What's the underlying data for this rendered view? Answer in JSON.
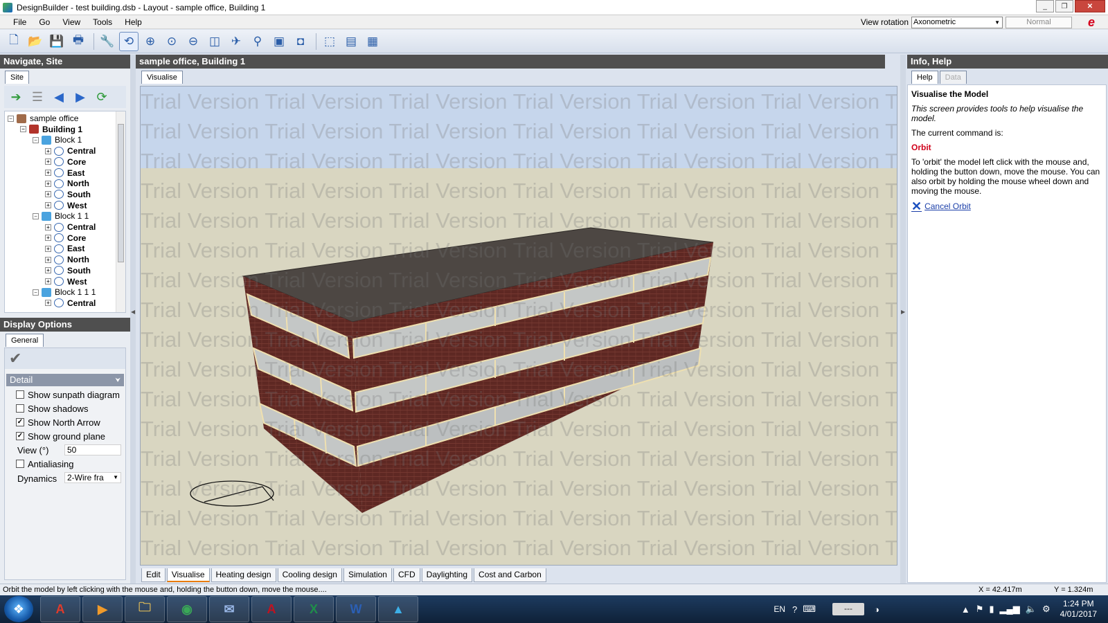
{
  "window": {
    "title": "DesignBuilder - test building.dsb - Layout - sample office, Building 1",
    "buttons": [
      "_",
      "❐",
      "✕"
    ]
  },
  "menu": {
    "items": [
      "File",
      "Go",
      "View",
      "Tools",
      "Help"
    ],
    "view_rotation_label": "View rotation",
    "view_rotation_value": "Axonometric",
    "mode_value": "Normal"
  },
  "toolbar": {
    "buttons": [
      {
        "name": "new-icon",
        "glyph": "🗋"
      },
      {
        "name": "open-icon",
        "glyph": "📂"
      },
      {
        "name": "save-icon",
        "glyph": "💾"
      },
      {
        "name": "print-icon",
        "glyph": "🖶"
      },
      {
        "name": "settings-wrench-icon",
        "glyph": "🔧"
      },
      {
        "name": "orbit-icon",
        "glyph": "⟲"
      },
      {
        "name": "zoom-icon",
        "glyph": "⊕"
      },
      {
        "name": "zoom-extents-icon",
        "glyph": "⊙"
      },
      {
        "name": "pan-icon",
        "glyph": "⊖"
      },
      {
        "name": "fit-icon",
        "glyph": "◫"
      },
      {
        "name": "fly-icon",
        "glyph": "✈"
      },
      {
        "name": "walk-icon",
        "glyph": "⚲"
      },
      {
        "name": "layers-icon",
        "glyph": "▣"
      },
      {
        "name": "camera-icon",
        "glyph": "◘"
      },
      {
        "name": "measure-icon",
        "glyph": "⬚"
      },
      {
        "name": "report-icon",
        "glyph": "▤"
      },
      {
        "name": "export-icon",
        "glyph": "▦"
      }
    ]
  },
  "navigate": {
    "header": "Navigate, Site",
    "tab": "Site",
    "tree": [
      {
        "label": "sample office",
        "level": 0,
        "icon": "site",
        "bold": false
      },
      {
        "label": "Building 1",
        "level": 1,
        "icon": "bldg",
        "bold": true
      },
      {
        "label": "Block 1",
        "level": 2,
        "icon": "block",
        "bold": false
      },
      {
        "label": "Central",
        "level": 3,
        "icon": "zone",
        "bold": true
      },
      {
        "label": "Core",
        "level": 3,
        "icon": "zone",
        "bold": true
      },
      {
        "label": "East",
        "level": 3,
        "icon": "zone",
        "bold": true
      },
      {
        "label": "North",
        "level": 3,
        "icon": "zone",
        "bold": true
      },
      {
        "label": "South",
        "level": 3,
        "icon": "zone",
        "bold": true
      },
      {
        "label": "West",
        "level": 3,
        "icon": "zone",
        "bold": true
      },
      {
        "label": "Block 1 1",
        "level": 2,
        "icon": "block",
        "bold": false
      },
      {
        "label": "Central",
        "level": 3,
        "icon": "zone",
        "bold": true
      },
      {
        "label": "Core",
        "level": 3,
        "icon": "zone",
        "bold": true
      },
      {
        "label": "East",
        "level": 3,
        "icon": "zone",
        "bold": true
      },
      {
        "label": "North",
        "level": 3,
        "icon": "zone",
        "bold": true
      },
      {
        "label": "South",
        "level": 3,
        "icon": "zone",
        "bold": true
      },
      {
        "label": "West",
        "level": 3,
        "icon": "zone",
        "bold": true
      },
      {
        "label": "Block 1 1 1",
        "level": 2,
        "icon": "block",
        "bold": false
      },
      {
        "label": "Central",
        "level": 3,
        "icon": "zone",
        "bold": true
      }
    ]
  },
  "display_options": {
    "header": "Display Options",
    "tab": "General",
    "section": "Detail",
    "options": [
      {
        "label": "Show sunpath diagram",
        "checked": false
      },
      {
        "label": "Show shadows",
        "checked": false
      },
      {
        "label": "Show North Arrow",
        "checked": true
      },
      {
        "label": "Show ground plane",
        "checked": true
      }
    ],
    "view_label": "View (°)",
    "view_value": "50",
    "antialiasing_label": "Antialiasing",
    "antialiasing_checked": false,
    "dynamics_label": "Dynamics",
    "dynamics_value": "2-Wire fra"
  },
  "center": {
    "header": "sample office, Building 1",
    "tab": "Visualise",
    "watermark": "Trial Version",
    "bottom_tabs": [
      "Edit",
      "Visualise",
      "Heating design",
      "Cooling design",
      "Simulation",
      "CFD",
      "Daylighting",
      "Cost and Carbon"
    ],
    "active_tab": "Visualise"
  },
  "help": {
    "header": "Info, Help",
    "tabs": [
      "Help",
      "Data"
    ],
    "title": "Visualise the Model",
    "description": "This screen provides tools to help visualise the model.",
    "command_label": "The current command is:",
    "command": "Orbit",
    "instructions": "To 'orbit' the model left click with the mouse and, holding the button down, move the mouse. You can also orbit by holding the mouse wheel down and moving the mouse.",
    "cancel_link": "Cancel Orbit"
  },
  "status": {
    "message": "Orbit the model by left clicking with the mouse and, holding the button down, move the mouse....",
    "x": "X = 42.417m",
    "y": "Y = 1.324m"
  },
  "taskbar": {
    "apps": [
      {
        "name": "pdf-reader-app",
        "glyph": "A",
        "color": "#e03b2b"
      },
      {
        "name": "media-player-app",
        "glyph": "▶",
        "color": "#f09a2a"
      },
      {
        "name": "file-explorer-app",
        "glyph": "🗀",
        "color": "#e8c056"
      },
      {
        "name": "chrome-app",
        "glyph": "◉",
        "color": "#3aa757"
      },
      {
        "name": "thunderbird-app",
        "glyph": "✉",
        "color": "#9ab8e8"
      },
      {
        "name": "acrobat-app",
        "glyph": "A",
        "color": "#c1121f"
      },
      {
        "name": "excel-app",
        "glyph": "X",
        "color": "#1f8e4a"
      },
      {
        "name": "word-app",
        "glyph": "W",
        "color": "#2b5fb4"
      },
      {
        "name": "designbuilder-app",
        "glyph": "▲",
        "color": "#3db0e8"
      }
    ],
    "lang": "EN",
    "tray_box": "---",
    "time": "1:24 PM",
    "date": "4/01/2017"
  }
}
